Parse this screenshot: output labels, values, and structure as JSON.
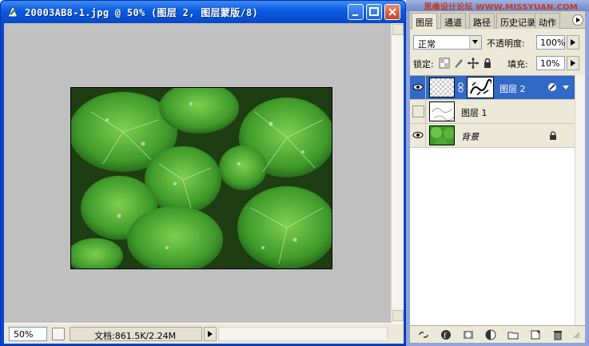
{
  "document_window": {
    "title": "20003AB8-1.jpg @ 50% (图层 2, 图层蒙版/8)",
    "zoom": "50%",
    "doc_info": "文档:861.5K/2.24M"
  },
  "watermark": "思缘设计论坛 WWW.MISSYUAN.COM",
  "layers_panel": {
    "tabs": [
      {
        "label": "图层"
      },
      {
        "label": "通道"
      },
      {
        "label": "路径"
      },
      {
        "label": "历史记录"
      },
      {
        "label": "动作"
      }
    ],
    "blend_mode": "正常",
    "opacity_label": "不透明度:",
    "opacity": "100%",
    "lock_label": "锁定:",
    "fill_label": "填充:",
    "fill": "10%",
    "layers": [
      {
        "name": "图层 2",
        "selected": true,
        "visible": true
      },
      {
        "name": "图层 1",
        "selected": false,
        "visible": false
      },
      {
        "name": "背景",
        "selected": false,
        "visible": true
      }
    ]
  },
  "colors": {
    "title_bar_blue": "#0a5be0",
    "selection_blue": "#3169c6",
    "canvas_gray": "#c0c0c0",
    "panel_beige": "#ece9d8",
    "leaf_green": "#3f9a2a"
  }
}
